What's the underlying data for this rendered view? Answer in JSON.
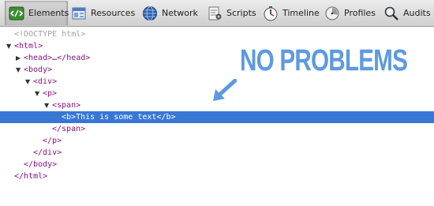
{
  "toolbar": {
    "tabs": [
      {
        "label": "Elements",
        "icon": "elements-icon"
      },
      {
        "label": "Resources",
        "icon": "resources-icon"
      },
      {
        "label": "Network",
        "icon": "network-icon"
      },
      {
        "label": "Scripts",
        "icon": "scripts-icon"
      },
      {
        "label": "Timeline",
        "icon": "timeline-icon"
      },
      {
        "label": "Profiles",
        "icon": "profiles-icon"
      },
      {
        "label": "Audits",
        "icon": "audits-icon"
      }
    ],
    "selected_tab": "Elements"
  },
  "dom_tree": {
    "doctype": "<!DOCTYPE html>",
    "html_open": "<html>",
    "head": "<head>",
    "head_ellipsis": "…",
    "head_close": "</head>",
    "body_open": "<body>",
    "div_open": "<div>",
    "p_open": "<p>",
    "span_open": "<span>",
    "b_open": "<b>",
    "b_text": "This is some text",
    "b_close": "</b>",
    "span_close": "</span>",
    "p_close": "</p>",
    "div_close": "</div>",
    "body_close": "</body>",
    "html_close": "</html>"
  },
  "annotation": {
    "text": "NO PROBLEMS",
    "color": "#5d9ae0"
  },
  "colors": {
    "selection": "#3877d6",
    "tag": "#881280",
    "doctype": "#a0a0a0"
  }
}
